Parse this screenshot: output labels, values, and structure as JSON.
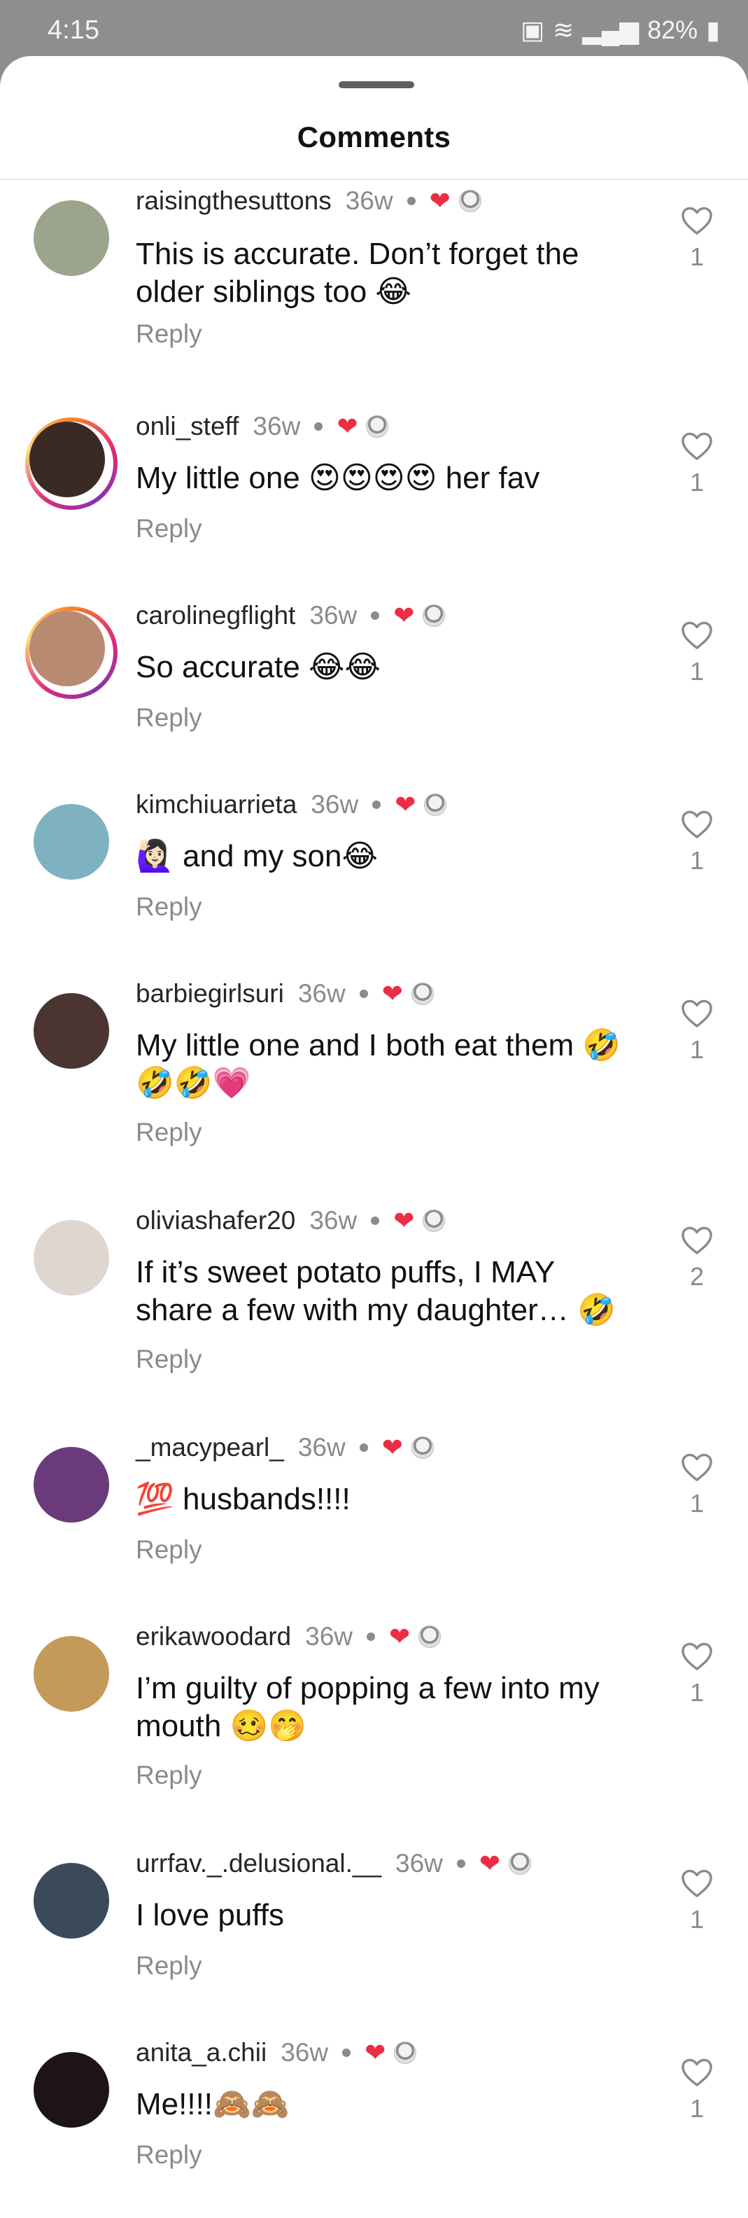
{
  "status": {
    "time": "4:15",
    "battery": "82%"
  },
  "sheet": {
    "title": "Comments"
  },
  "colors": {
    "heart": "#ed2c46",
    "muted": "#8a8a8a"
  },
  "comments": [
    {
      "user": "raisingthesuttons",
      "time": "36w",
      "text": "This is accurate. Don’t forget the older siblings too 😂",
      "reply": "Reply",
      "likes": "1",
      "avatar_color": "#9aa58c",
      "story": false
    },
    {
      "user": "onli_steff",
      "time": "36w",
      "text": "My little one 😍😍😍😍 her fav",
      "reply": "Reply",
      "likes": "1",
      "avatar_color": "#3b2a24",
      "story": true
    },
    {
      "user": "carolinegflight",
      "time": "36w",
      "text": "So accurate 😂😂",
      "reply": "Reply",
      "likes": "1",
      "avatar_color": "#b98a72",
      "story": true
    },
    {
      "user": "kimchiuarrieta",
      "time": "36w",
      "text": "🙋🏻‍♀️ and my son😂",
      "reply": "Reply",
      "likes": "1",
      "avatar_color": "#7fb2c1",
      "story": false
    },
    {
      "user": "barbiegirlsuri",
      "time": "36w",
      "text": "My little one and I both eat them 🤣🤣🤣💗",
      "reply": "Reply",
      "likes": "1",
      "avatar_color": "#4a3530",
      "story": false
    },
    {
      "user": "oliviashafer20",
      "time": "36w",
      "text": "If it’s sweet potato puffs, I MAY share a few with my daughter… 🤣",
      "reply": "Reply",
      "likes": "2",
      "avatar_color": "#e0d6d0",
      "story": false
    },
    {
      "user": "_macypearl_",
      "time": "36w",
      "text": "💯 husbands!!!!",
      "reply": "Reply",
      "likes": "1",
      "avatar_color": "#6b3a7a",
      "story": false
    },
    {
      "user": "erikawoodard",
      "time": "36w",
      "text": "I’m guilty of popping a few into my mouth 🥴🤭",
      "reply": "Reply",
      "likes": "1",
      "avatar_color": "#c49a5a",
      "story": false
    },
    {
      "user": "urrfav._.delusional.__",
      "time": "36w",
      "text": "I love puffs",
      "reply": "Reply",
      "likes": "1",
      "avatar_color": "#3a4a5a",
      "story": false
    },
    {
      "user": "anita_a.chii",
      "time": "36w",
      "text": "Me!!!!🙈🙈",
      "reply": "Reply",
      "likes": "1",
      "avatar_color": "#1e1418",
      "story": false
    }
  ]
}
